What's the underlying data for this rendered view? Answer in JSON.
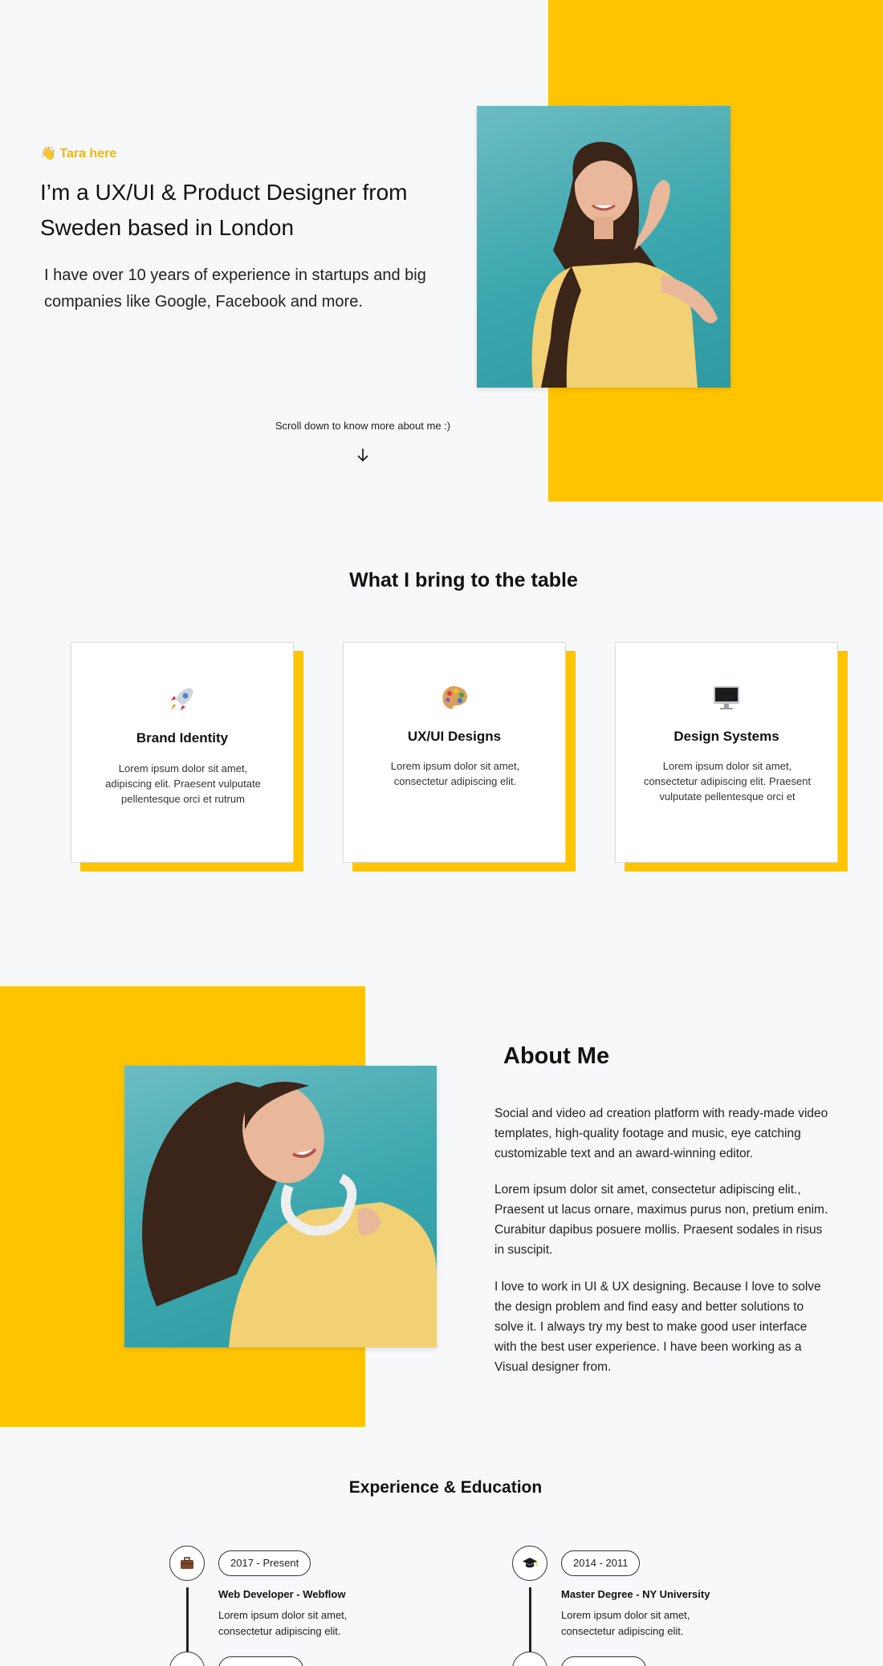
{
  "hero": {
    "greeting": "👋 Tara here",
    "headline": "I’m a UX/UI & Product Designer from Sweden based in London",
    "intro": "I have over 10 years of experience in startups and big companies like Google, Facebook and more.",
    "scroll_note": "Scroll down to know more about me :)",
    "scroll_icon": "arrow-down-icon",
    "photo_alt": "portrait photo"
  },
  "services": {
    "title": "What I bring to the table",
    "cards": [
      {
        "icon": "rocket-icon",
        "title": "Brand Identity",
        "text": "Lorem ipsum dolor sit amet, adipiscing elit. Praesent vulputate pellentesque orci et rutrum"
      },
      {
        "icon": "palette-icon",
        "title": "UX/UI Designs",
        "text": "Lorem ipsum dolor sit amet, consectetur adipiscing elit."
      },
      {
        "icon": "desktop-computer-icon",
        "title": "Design Systems",
        "text": "Lorem ipsum dolor sit amet, consectetur adipiscing elit. Praesent vulputate pellentesque orci et"
      }
    ]
  },
  "about": {
    "title": "About Me",
    "paragraphs": [
      "Social and video ad creation platform with ready-made video templates, high-quality footage and music, eye catching customizable text and an award-winning editor.",
      "Lorem ipsum dolor sit amet, consectetur adipiscing elit., Praesent ut lacus ornare, maximus purus non, pretium enim. Curabitur dapibus posuere mollis. Praesent sodales in risus in suscipit.",
      "I love to work in UI & UX designing. Because I love to solve the design problem and find easy and better solutions to solve it. I always try my best to make good user interface with the best user experience. I have been working as a Visual designer from."
    ]
  },
  "experience": {
    "title": "Experience & Education",
    "items": [
      {
        "icon": "briefcase-icon",
        "period": "2017 - Present",
        "role": "Web Developer - Webflow",
        "desc": "Lorem ipsum dolor sit amet, consectetur adipiscing elit."
      },
      {
        "icon": "graduation-cap-icon",
        "period": "2014 - 2011",
        "role": "Master Degree - NY University",
        "desc": "Lorem ipsum dolor sit amet, consectetur adipiscing elit."
      }
    ]
  },
  "colors": {
    "accent_yellow": "#ffc400",
    "greeting_yellow": "#f2b705",
    "photo_teal": "#3aa6ad",
    "background": "#f7f8fa"
  }
}
